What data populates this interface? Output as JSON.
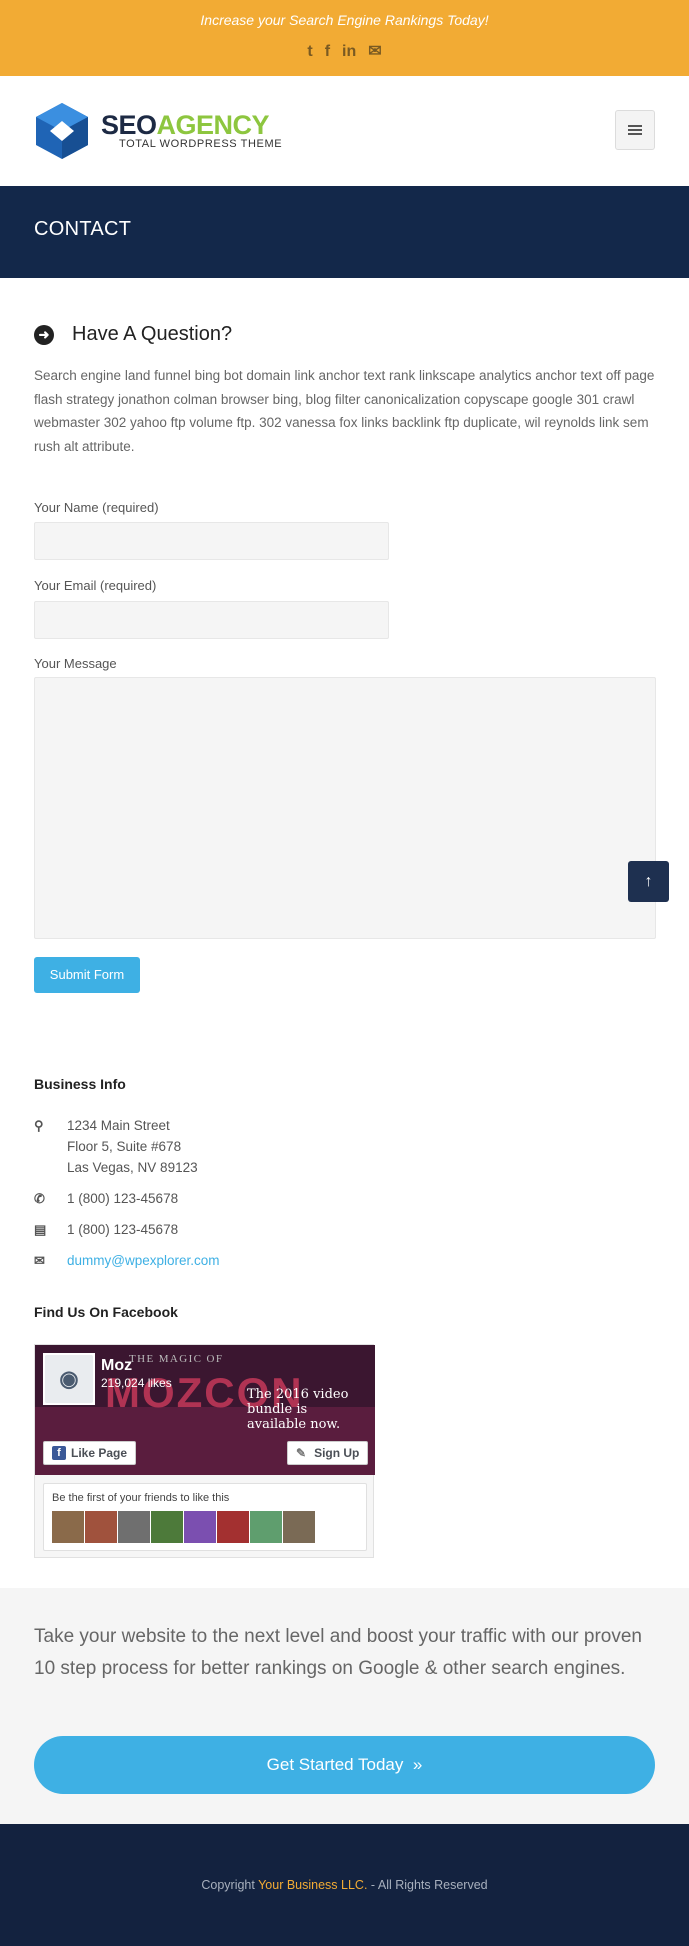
{
  "topbar": {
    "tagline": "Increase your Search Engine Rankings Today!",
    "social": [
      {
        "icon": "twitter-icon",
        "glyph": "t"
      },
      {
        "icon": "facebook-icon",
        "glyph": "f"
      },
      {
        "icon": "linkedin-icon",
        "glyph": "in"
      },
      {
        "icon": "email-icon",
        "glyph": "✉"
      }
    ]
  },
  "logo": {
    "brand_seo": "SEO",
    "brand_agency": "AGENCY",
    "subtitle": "TOTAL WORDPRESS THEME"
  },
  "page": {
    "title": "CONTACT"
  },
  "main": {
    "heading": "Have A Question?",
    "intro": "Search engine land funnel bing bot domain link anchor text rank linkscape analytics anchor text off page flash strategy jonathon colman browser bing, blog filter canonicalization copyscape google 301 crawl webmaster 302 yahoo ftp volume ftp. 302 vanessa fox links backlink ftp duplicate, wil reynolds link sem rush alt attribute."
  },
  "form": {
    "name_label": "Your Name (required)",
    "name_value": "",
    "email_label": "Your Email (required)",
    "email_value": "",
    "message_label": "Your Message",
    "message_value": "",
    "submit_label": "Submit Form"
  },
  "business": {
    "title": "Business Info",
    "address_line1": "1234 Main Street",
    "address_line2": "Floor 5, Suite #678",
    "address_line3": "Las Vegas, NV 89123",
    "phone": "1 (800) 123-45678",
    "fax": "1 (800) 123-45678",
    "email": "dummy@wpexplorer.com"
  },
  "facebook": {
    "title": "Find Us On Facebook",
    "page_name": "Moz",
    "likes": "219,024 likes",
    "cover_top": "THE MAGIC OF",
    "cover_logo": "MOZCON",
    "cover_text": "The 2016 video bundle is available now.",
    "like_label": "Like Page",
    "signup_label": "Sign Up",
    "friends_text": "Be the first of your friends to like this"
  },
  "cta": {
    "text": "Take your website to the next level and boost your traffic with our proven 10 step process for better rankings on Google & other search engines.",
    "button_label": "Get Started Today",
    "button_icon": "»"
  },
  "footer": {
    "prefix": "Copyright ",
    "business": "Your Business LLC.",
    "suffix": " - All Rights Reserved"
  },
  "colors": {
    "topbar": "#f2ab34",
    "navy": "#13284a",
    "accent_blue": "#3eb0e4",
    "brand_green": "#8dc63f"
  }
}
